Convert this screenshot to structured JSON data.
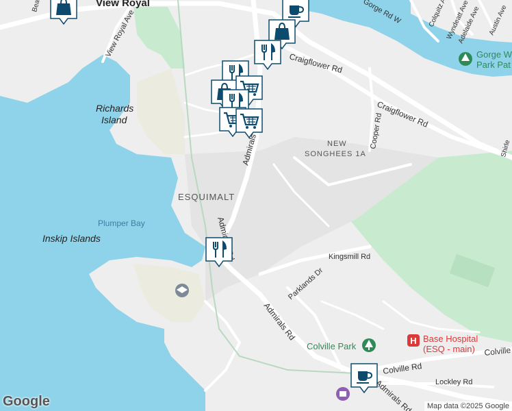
{
  "places": {
    "view_royal": "View Royal",
    "richards_island_1": "Richards",
    "richards_island_2": "Island",
    "esquimalt": "ESQUIMALT",
    "plumper_bay": "Plumper Bay",
    "inskip_islands": "Inskip Islands",
    "new_songhees_1": "NEW",
    "new_songhees_2": "SONGHEES 1A",
    "colville_park": "Colville Park",
    "base_hospital_1": "Base Hospital",
    "base_hospital_2": "(ESQ - main)",
    "gorge_park_1": "Gorge W",
    "gorge_park_2": "Park Pat"
  },
  "roads": {
    "craigflower_1": "Craigflower Rd",
    "craigflower_2": "Craigflower Rd",
    "admirals_1": "Admirals Rd",
    "admirals_2": "Admirals Rd",
    "admirals_3": "Admirals Rd",
    "admirals_4": "Admirals Rd",
    "view_royal_ave": "View Royal Ave",
    "cooper_rd": "Cooper Rd",
    "kingsmill_rd": "Kingsmill Rd",
    "parklands_dr": "Parklands Dr",
    "colville_rd_1": "Colville Rd",
    "colville_rd_2": "Colville",
    "lockley_rd": "Lockley Rd",
    "gorge_rd_w": "Gorge Rd W",
    "colquitz_ave": "Colquitz Ave",
    "wyndeatt_ave": "Wyndeatt Ave",
    "adelaide_ave": "Adelaide Ave",
    "austin_ave": "Austin Ave",
    "shirley": "Shirle",
    "beach": "Bea"
  },
  "markers": [
    {
      "type": "shopping",
      "icon": "shopping-bag-icon"
    },
    {
      "type": "cafe",
      "icon": "coffee-cup-icon"
    },
    {
      "type": "shopping",
      "icon": "shopping-bag-icon"
    },
    {
      "type": "restaurant",
      "icon": "fork-knife-icon"
    },
    {
      "type": "restaurant",
      "icon": "fork-knife-icon"
    },
    {
      "type": "shopping",
      "icon": "shopping-bag-icon"
    },
    {
      "type": "grocery",
      "icon": "shopping-cart-icon"
    },
    {
      "type": "restaurant",
      "icon": "fork-knife-icon"
    },
    {
      "type": "grocery",
      "icon": "shopping-cart-icon"
    },
    {
      "type": "grocery",
      "icon": "shopping-cart-icon"
    },
    {
      "type": "restaurant",
      "icon": "fork-knife-icon"
    },
    {
      "type": "cafe",
      "icon": "coffee-cup-icon"
    }
  ],
  "attribution": "Map data ©2025 Google",
  "logo": "Google",
  "colors": {
    "water": "#8fd3ea",
    "land": "#eeeeee",
    "park": "#c8ebd0",
    "marker": "#0c4a6e",
    "hospital": "#d93a3a",
    "park_poi": "#2e8b57"
  }
}
